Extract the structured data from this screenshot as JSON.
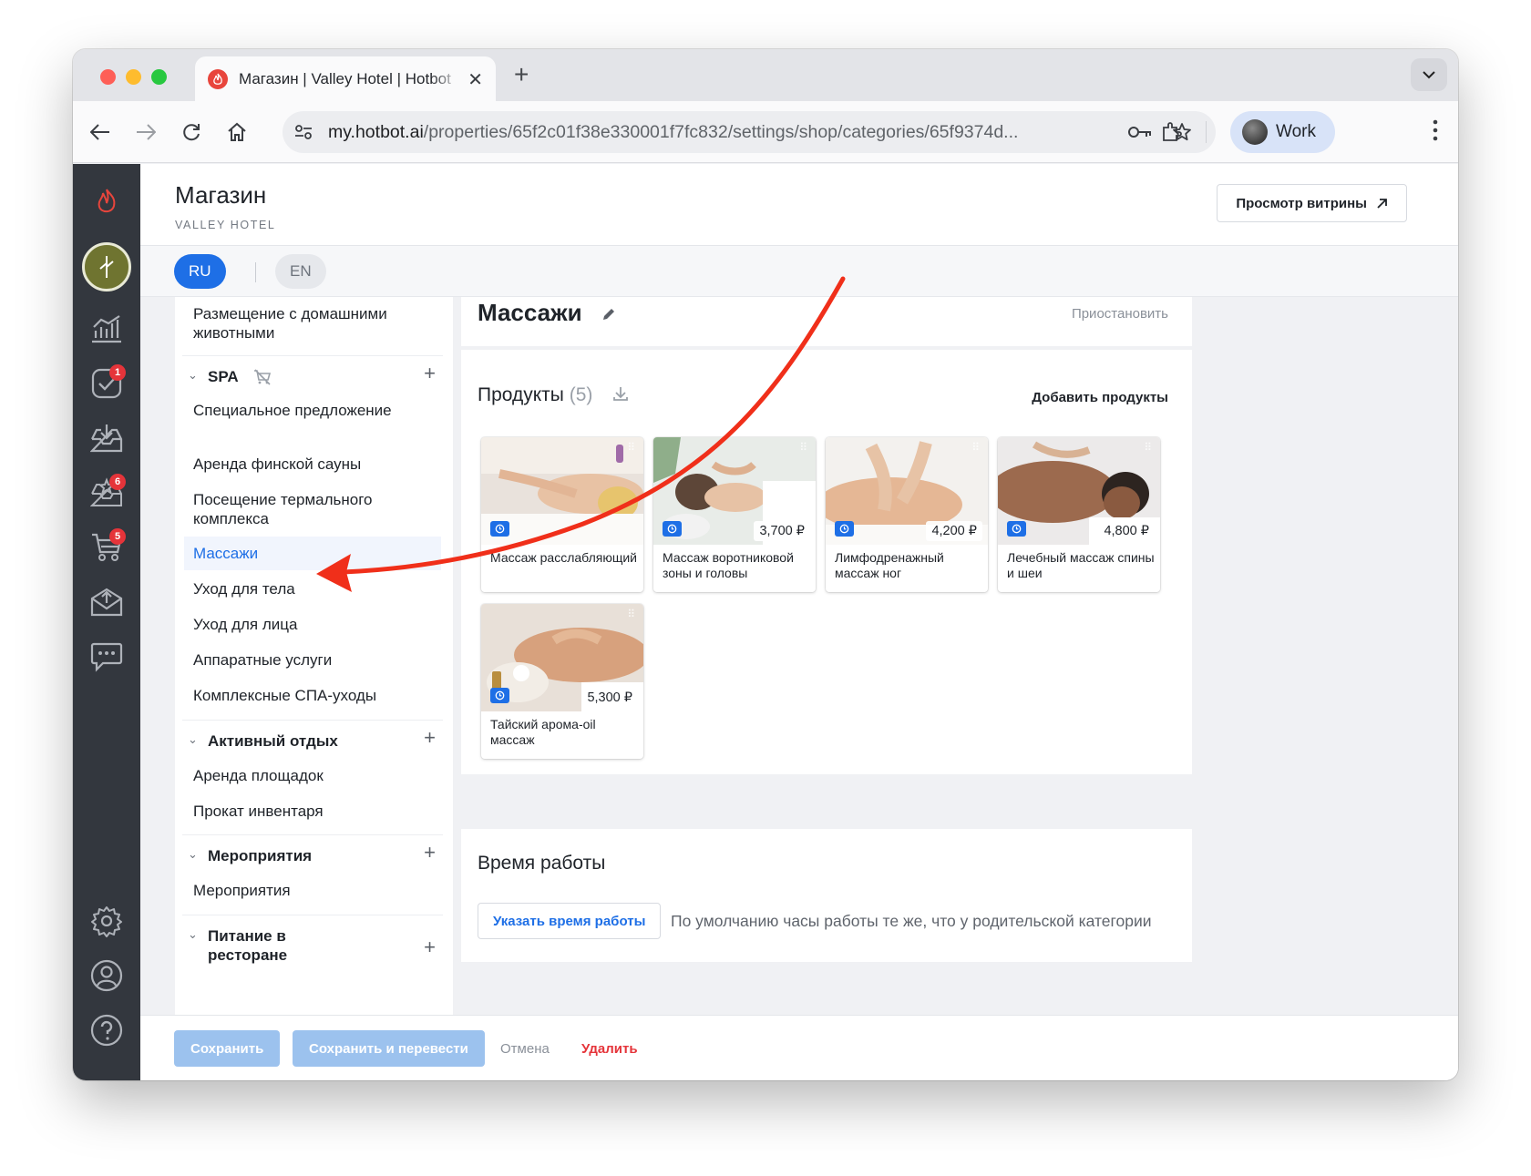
{
  "browser": {
    "tab_title": "Магазин | Valley Hotel | Hotbot",
    "url_host": "my.hotbot.ai",
    "url_path": "/properties/65f2c01f38e330001f7fc832/settings/shop/categories/65f9374d...",
    "profile_label": "Work"
  },
  "rail": {
    "badges": {
      "tasks": "1",
      "reviews": "6",
      "orders": "5"
    }
  },
  "header": {
    "title": "Магазин",
    "subtitle": "VALLEY HOTEL",
    "storefront_button": "Просмотр витрины"
  },
  "languages": {
    "active": "RU",
    "inactive": "EN"
  },
  "tree": {
    "top_leaf": "Размещение с домашними животными",
    "spa": {
      "label": "SPA",
      "items": [
        "Специальное предложение",
        "Аренда финской сауны",
        "Посещение термального комплекса",
        "Массажи",
        "Уход для тела",
        "Уход для лица",
        "Аппаратные услуги",
        "Комплексные СПА-уходы"
      ]
    },
    "active_group": {
      "label": "Активный отдых",
      "items": [
        "Аренда площадок",
        "Прокат инвентаря"
      ]
    },
    "events": {
      "label": "Мероприятия",
      "items": [
        "Мероприятия"
      ]
    },
    "restaurant": {
      "label": "Питание в ресторане"
    }
  },
  "category": {
    "title": "Массажи",
    "pause_link": "Приостановить",
    "products_label": "Продукты",
    "products_count": "(5)",
    "add_products": "Добавить продукты",
    "products": [
      {
        "name": "Массаж расслабляющий",
        "price": ""
      },
      {
        "name": "Массаж воротниковой зоны и головы",
        "price": "3,700 ₽"
      },
      {
        "name": "Лимфодренажный массаж ног",
        "price": "4,200 ₽"
      },
      {
        "name": "Лечебный массаж спины и шеи",
        "price": "4,800 ₽"
      },
      {
        "name": "Тайский арома-oil массаж",
        "price": "5,300 ₽"
      }
    ]
  },
  "hours": {
    "title": "Время работы",
    "button": "Указать время работы",
    "note": "По умолчанию часы работы те же, что у родительской категории"
  },
  "footer": {
    "save": "Сохранить",
    "save_translate": "Сохранить и перевести",
    "cancel": "Отмена",
    "delete": "Удалить"
  },
  "colors": {
    "accent": "#1e6fe6",
    "annotation_arrow": "#f02f1a",
    "danger": "#e5343a",
    "rail": "#33373e"
  }
}
